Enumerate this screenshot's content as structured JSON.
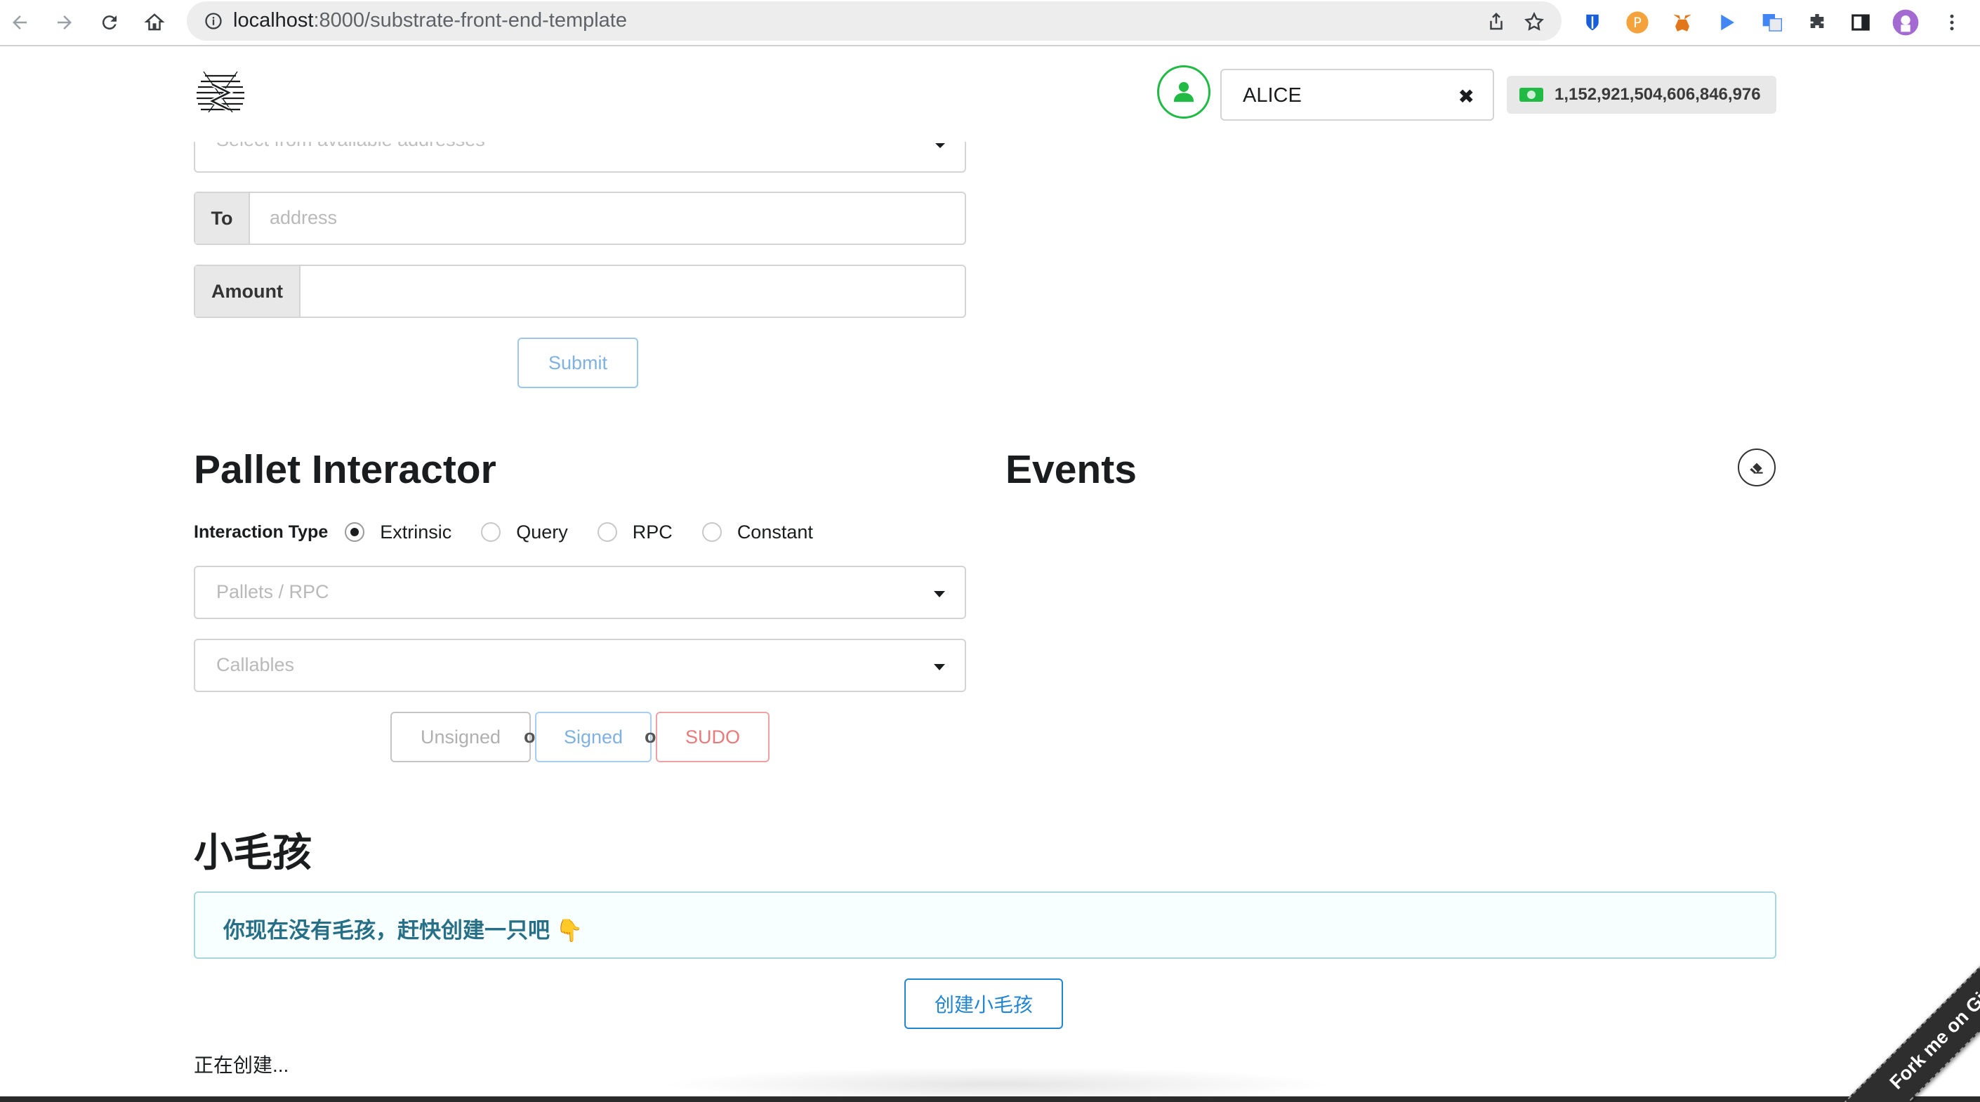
{
  "browser": {
    "url_host": "localhost",
    "url_path": ":8000/substrate-front-end-template"
  },
  "header": {
    "account_name": "ALICE",
    "balance": "1,152,921,504,606,846,976"
  },
  "transfer": {
    "from_placeholder": "Select from available addresses",
    "to_label": "To",
    "to_placeholder": "address",
    "amount_label": "Amount",
    "submit_label": "Submit"
  },
  "pallet_interactor": {
    "title": "Pallet Interactor",
    "interaction_type_label": "Interaction Type",
    "options": [
      "Extrinsic",
      "Query",
      "RPC",
      "Constant"
    ],
    "selected": "Extrinsic",
    "pallets_placeholder": "Pallets / RPC",
    "callables_placeholder": "Callables",
    "unsigned_label": "Unsigned",
    "signed_label": "Signed",
    "sudo_label": "SUDO",
    "or_text": "or"
  },
  "events": {
    "title": "Events"
  },
  "kitties": {
    "title": "小毛孩",
    "message": "你现在没有毛孩，赶快创建一只吧 👇",
    "create_label": "创建小毛孩",
    "status": "正在创建..."
  },
  "ribbon": {
    "text": "Fork me on GitHub"
  },
  "colors": {
    "accent_green": "#21ba45",
    "signed_blue": "#54a0e0",
    "sudo_red": "#db2828",
    "info_text": "#276f86"
  }
}
